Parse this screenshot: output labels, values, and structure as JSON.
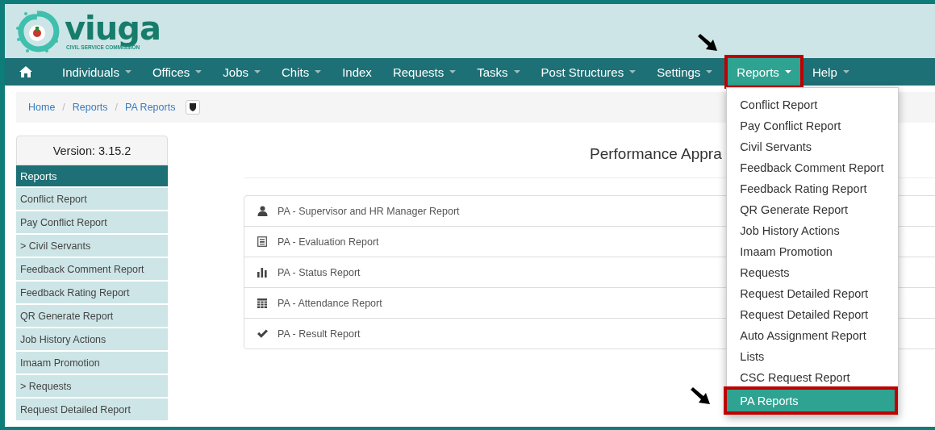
{
  "header": {
    "brand": "viuga",
    "subtitle": "CIVIL SERVICE COMMISSION"
  },
  "nav": {
    "items": [
      {
        "kind": "home",
        "caret": false,
        "selected": false,
        "expanded": false,
        "annotated": false
      },
      {
        "kind": "link",
        "label": "Individuals",
        "caret": true,
        "selected": false,
        "expanded": false,
        "annotated": false
      },
      {
        "kind": "link",
        "label": "Offices",
        "caret": true,
        "selected": false,
        "expanded": false,
        "annotated": false
      },
      {
        "kind": "link",
        "label": "Jobs",
        "caret": true,
        "selected": false,
        "expanded": false,
        "annotated": false
      },
      {
        "kind": "link",
        "label": "Chits",
        "caret": true,
        "selected": false,
        "expanded": false,
        "annotated": false
      },
      {
        "kind": "link",
        "label": "Index",
        "caret": false,
        "selected": false,
        "expanded": false,
        "annotated": false
      },
      {
        "kind": "link",
        "label": "Requests",
        "caret": true,
        "selected": false,
        "expanded": false,
        "annotated": false
      },
      {
        "kind": "link",
        "label": "Tasks",
        "caret": true,
        "selected": false,
        "expanded": false,
        "annotated": false
      },
      {
        "kind": "link",
        "label": "Post Structures",
        "caret": true,
        "selected": false,
        "expanded": false,
        "annotated": false
      },
      {
        "kind": "link",
        "label": "Settings",
        "caret": true,
        "selected": false,
        "expanded": false,
        "annotated": false
      },
      {
        "kind": "link",
        "label": "Reports",
        "caret": true,
        "selected": true,
        "expanded": true,
        "annotated": true
      },
      {
        "kind": "link",
        "label": "Help",
        "caret": true,
        "selected": false,
        "expanded": false,
        "annotated": false
      }
    ],
    "dropdown": [
      {
        "label": "Conflict Report",
        "selected": false,
        "annotated": false
      },
      {
        "label": "Pay Conflict Report",
        "selected": false,
        "annotated": false
      },
      {
        "label": "Civil Servants",
        "selected": false,
        "annotated": false
      },
      {
        "label": "Feedback Comment Report",
        "selected": false,
        "annotated": false
      },
      {
        "label": "Feedback Rating Report",
        "selected": false,
        "annotated": false
      },
      {
        "label": "QR Generate Report",
        "selected": false,
        "annotated": false
      },
      {
        "label": "Job History Actions",
        "selected": false,
        "annotated": false
      },
      {
        "label": "Imaam Promotion",
        "selected": false,
        "annotated": false
      },
      {
        "label": "Requests",
        "selected": false,
        "annotated": false
      },
      {
        "label": "Request Detailed Report",
        "selected": false,
        "annotated": false
      },
      {
        "label": "Request Detailed Report",
        "selected": false,
        "annotated": false
      },
      {
        "label": "Auto Assignment Report",
        "selected": false,
        "annotated": false
      },
      {
        "label": "Lists",
        "selected": false,
        "annotated": false
      },
      {
        "label": "CSC Request Report",
        "selected": false,
        "annotated": false
      },
      {
        "label": "PA Reports",
        "selected": true,
        "annotated": true
      }
    ]
  },
  "breadcrumb": {
    "links": [
      "Home",
      "Reports",
      "PA Reports"
    ],
    "separators": [
      "/",
      "/"
    ]
  },
  "sidebar": {
    "version": "Version: 3.15.2",
    "heading": "Reports",
    "items": [
      "Conflict Report",
      "Pay Conflict Report",
      "> Civil Servants",
      "Feedback Comment Report",
      "Feedback Rating Report",
      "QR Generate Report",
      "Job History Actions",
      "Imaam Promotion",
      "> Requests",
      "Request Detailed Report"
    ]
  },
  "main": {
    "title": "Performance Appra",
    "reports": [
      {
        "kind": "user",
        "label": "PA - Supervisor and HR Manager Report"
      },
      {
        "kind": "document",
        "label": "PA - Evaluation Report"
      },
      {
        "kind": "bars",
        "label": "PA - Status Report"
      },
      {
        "kind": "calendar",
        "label": "PA - Attendance Report"
      },
      {
        "kind": "check",
        "label": "PA - Result Report"
      }
    ]
  }
}
